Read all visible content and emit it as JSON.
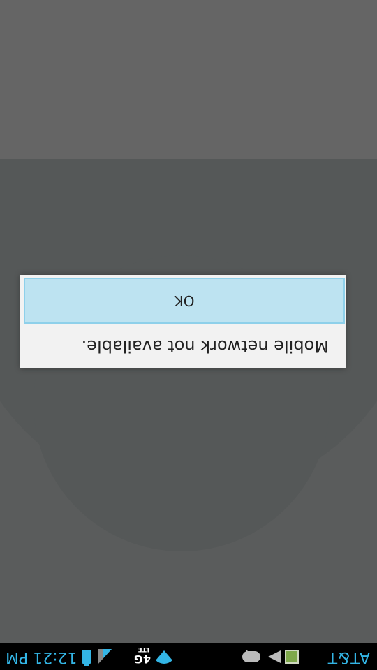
{
  "status_bar": {
    "carrier": "AT&T",
    "time": "12:21 PM",
    "network_badge": "4G",
    "network_sub": "LTE",
    "text_color": "#33b5e5",
    "icons": [
      "image-notification-icon",
      "play-store-icon",
      "chat-icon",
      "wifi-icon",
      "lte-icon",
      "signal-icon",
      "battery-icon"
    ]
  },
  "dialog": {
    "message": "Mobile network not available.",
    "ok_label": "OK",
    "button_color": "#bde3f1"
  },
  "orientation": "rotated-180"
}
